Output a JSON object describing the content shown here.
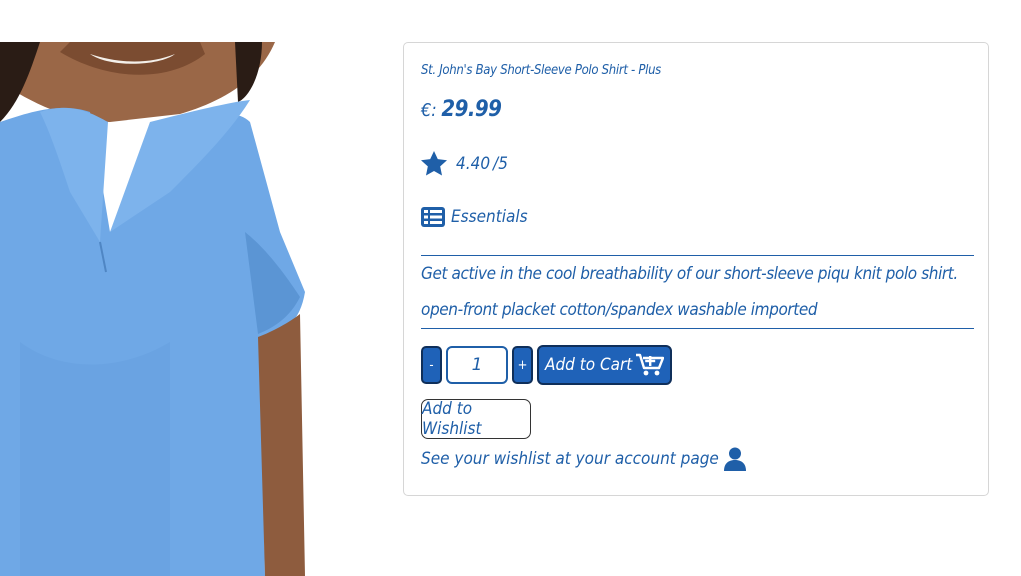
{
  "product": {
    "title": "St. John's Bay Short-Sleeve Polo Shirt - Plus",
    "currency_label": "€:",
    "price": "29.99",
    "rating": "4.40",
    "rating_max": "/5",
    "category": "Essentials",
    "description": "Get active in the cool breathability of our short-sleeve piqu knit polo shirt. open-front placket cotton/spandex washable imported"
  },
  "cart": {
    "decrement_label": "-",
    "quantity": "1",
    "increment_label": "+",
    "add_to_cart_label": "Add to Cart"
  },
  "wishlist": {
    "button_label": "Add to Wishlist",
    "note": "See your wishlist at your account page"
  },
  "colors": {
    "accent": "#1f5fa8",
    "button": "#1f62b8",
    "shirt": "#6fa8e6"
  },
  "icons": [
    "star-icon",
    "list-icon",
    "cart-plus-icon",
    "user-icon"
  ]
}
